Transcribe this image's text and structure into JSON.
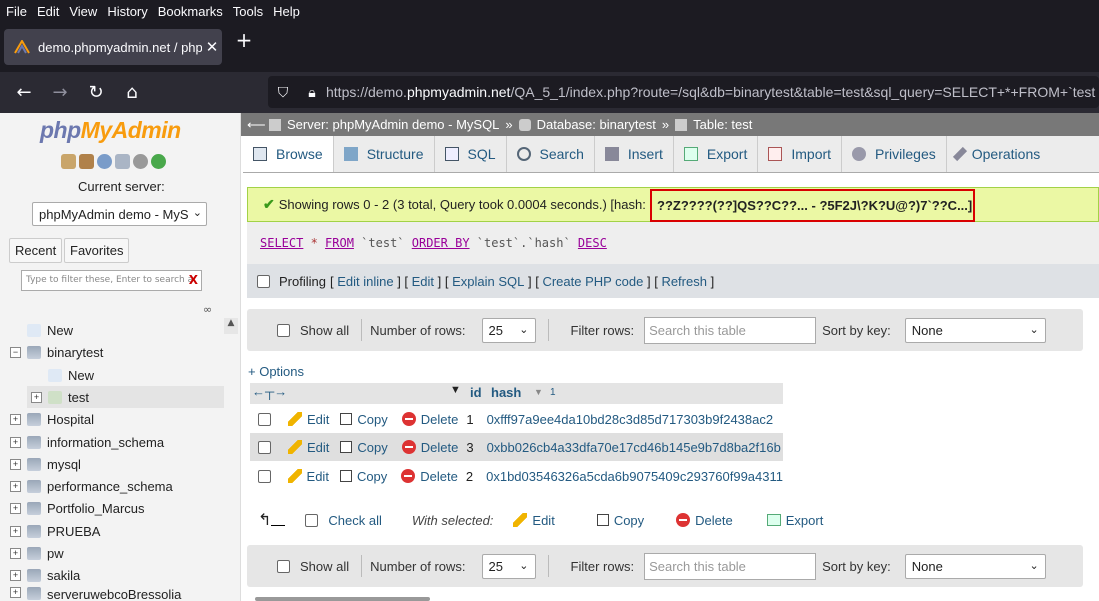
{
  "browser": {
    "menu": [
      "File",
      "Edit",
      "View",
      "History",
      "Bookmarks",
      "Tools",
      "Help"
    ],
    "tab_title": "demo.phpmyadmin.net / phpM",
    "url_prefix": "https://demo.",
    "url_domain": "phpmyadmin.net",
    "url_rest": "/QA_5_1/index.php?route=/sql&db=binarytest&table=test&sql_query=SELECT+*+FROM+`test"
  },
  "sidebar": {
    "logo_php": "php",
    "logo_myadmin": "MyAdmin",
    "current_server_label": "Current server:",
    "server_select": "phpMyAdmin demo - MyS",
    "recent": "Recent",
    "favorites": "Favorites",
    "filter_placeholder": "Type to filter these, Enter to search a",
    "filter_clear": "X",
    "tree": [
      {
        "label": "New"
      },
      {
        "label": "binarytest"
      },
      {
        "label": "New"
      },
      {
        "label": "test"
      },
      {
        "label": "Hospital"
      },
      {
        "label": "information_schema"
      },
      {
        "label": "mysql"
      },
      {
        "label": "performance_schema"
      },
      {
        "label": "Portfolio_Marcus"
      },
      {
        "label": "PRUEBA"
      },
      {
        "label": "pw"
      },
      {
        "label": "sakila"
      },
      {
        "label": "serveruwebcoBressolia"
      }
    ]
  },
  "breadcrumb": {
    "server": "Server: phpMyAdmin demo - MySQL",
    "database": "Database: binarytest",
    "table": "Table: test",
    "sep": "»"
  },
  "tabs": [
    "Browse",
    "Structure",
    "SQL",
    "Search",
    "Insert",
    "Export",
    "Import",
    "Privileges",
    "Operations"
  ],
  "message": {
    "text": "Showing rows 0 - 2 (3 total, Query took 0.0004 seconds.) [hash:",
    "hash": "??Z????(??]QS??C??... - ?5F2J\\?K?U@?)7`??C...]"
  },
  "sql": {
    "kw_select": "SELECT",
    "star": " * ",
    "kw_from": "FROM",
    "table": " `test` ",
    "kw_order": "ORDER BY",
    "col": " `test`.`hash` ",
    "kw_desc": "DESC"
  },
  "profiling": {
    "label": "Profiling",
    "links": [
      "Edit inline",
      "Edit",
      "Explain SQL",
      "Create PHP code",
      "Refresh"
    ]
  },
  "nav": {
    "show_all": "Show all",
    "num_rows_label": "Number of rows:",
    "num_rows": "25",
    "filter_label": "Filter rows:",
    "filter_placeholder": "Search this table",
    "sort_label": "Sort by key:",
    "sort_value": "None"
  },
  "options_link": "+ Options",
  "table": {
    "col_id": "id",
    "col_hash": "hash",
    "sort_index": "1",
    "actions": {
      "edit": "Edit",
      "copy": "Copy",
      "delete": "Delete"
    },
    "rows": [
      {
        "id": "1",
        "hash": "0xfff97a9ee4da10bd28c3d85d717303b9f2438ac2"
      },
      {
        "id": "3",
        "hash": "0xbb026cb4a33dfa70e17cd46b145e9b7d8ba2f16b"
      },
      {
        "id": "2",
        "hash": "0x1bd03546326a5cda6b9075409c293760f99a4311"
      }
    ]
  },
  "with_selected": {
    "check_all": "Check all",
    "label": "With selected:",
    "edit": "Edit",
    "copy": "Copy",
    "delete": "Delete",
    "export": "Export"
  },
  "colors": {
    "accent": "#235a81",
    "highlight_border": "#d90000",
    "success_bg": "#ebf8a4"
  }
}
